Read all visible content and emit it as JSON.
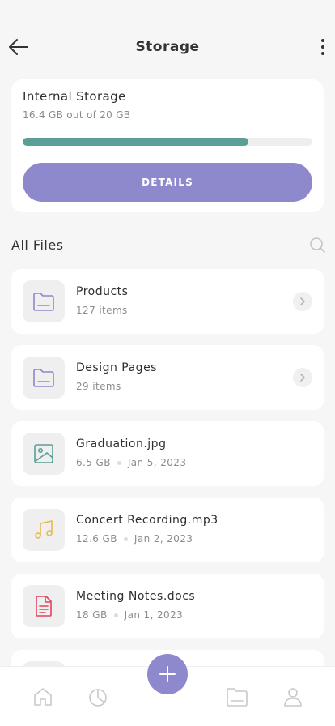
{
  "header": {
    "title": "Storage",
    "back_icon": "arrow-left-icon",
    "more_icon": "more-vertical-icon"
  },
  "storage": {
    "title": "Internal Storage",
    "subtitle": "16.4 GB out of 20 GB",
    "used_fraction": 0.78,
    "details_label": "DETAILS",
    "accent_color": "#8e88cd",
    "progress_color": "#5a9e97"
  },
  "files_section": {
    "title": "All Files",
    "search_icon": "search-icon"
  },
  "files": [
    {
      "name": "Products",
      "meta": "127 items",
      "icon": "folder-icon"
    },
    {
      "name": "Design Pages",
      "meta": "29 items",
      "icon": "folder-icon"
    },
    {
      "name": "Graduation.jpg",
      "size": "6.5 GB",
      "date": "Jan 5, 2023",
      "icon": "image-icon"
    },
    {
      "name": "Concert Recording.mp3",
      "size": "12.6 GB",
      "date": "Jan 2, 2023",
      "icon": "music-icon"
    },
    {
      "name": "Meeting Notes.docs",
      "size": "18 GB",
      "date": "Jan 1, 2023",
      "icon": "document-icon"
    }
  ],
  "bottom_nav": {
    "items": [
      "home-icon",
      "pie-chart-icon",
      "folder-icon",
      "user-icon"
    ],
    "fab_icon": "plus-icon"
  }
}
